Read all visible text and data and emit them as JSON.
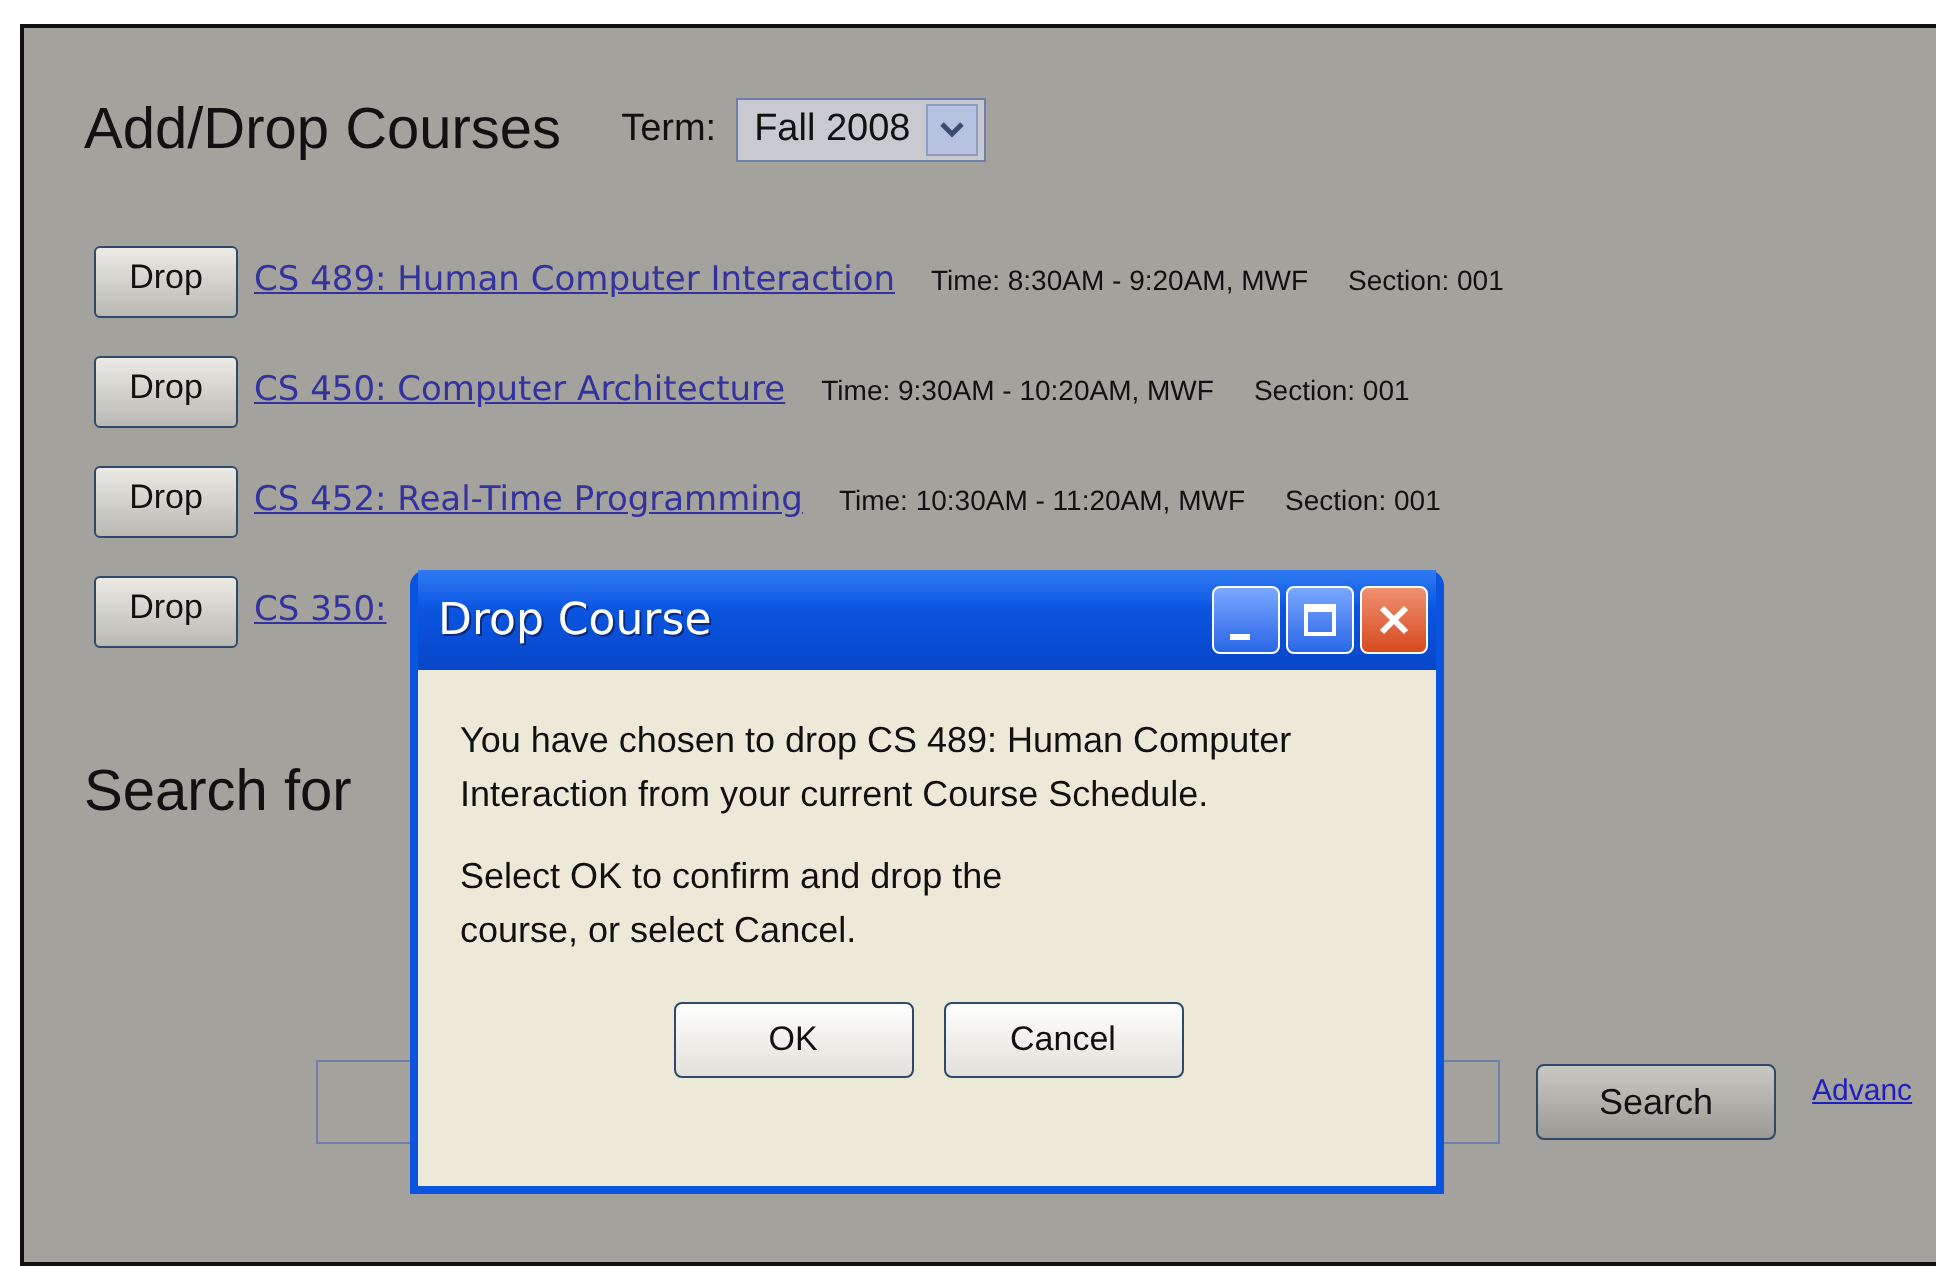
{
  "page": {
    "title": "Add/Drop Courses",
    "term_label": "Term:",
    "term_value": "Fall 2008"
  },
  "courses": [
    {
      "action": "Drop",
      "link": "CS 489: Human Computer Interaction",
      "time": "Time: 8:30AM - 9:20AM, MWF",
      "section": "Section: 001"
    },
    {
      "action": "Drop",
      "link": "CS 450: Computer Architecture",
      "time": "Time: 9:30AM - 10:20AM, MWF",
      "section": "Section: 001"
    },
    {
      "action": "Drop",
      "link": "CS 452: Real-Time Programming",
      "time": "Time: 10:30AM - 11:20AM, MWF",
      "section": "Section: 001"
    },
    {
      "action": "Drop",
      "link": "CS 350:"
    }
  ],
  "search": {
    "heading": "Search for",
    "button": "Search",
    "link": "Advanc"
  },
  "dialog": {
    "title": "Drop Course",
    "paragraphs": [
      "You have chosen to drop CS 489: Human Computer Interaction from your current Course Schedule.",
      "Select OK to confirm and drop the course, or select Cancel."
    ],
    "buttons": [
      "OK",
      "Cancel"
    ]
  }
}
